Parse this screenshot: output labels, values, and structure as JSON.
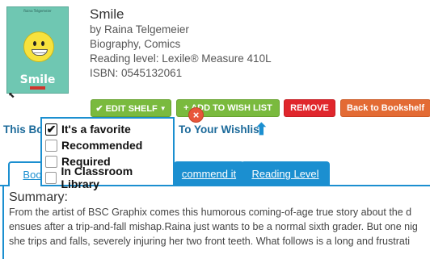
{
  "book": {
    "cover": {
      "author": "Raina Telgemeier",
      "title": "Smile"
    },
    "title": "Smile",
    "author_line": "by Raina Telgemeier",
    "genres": "Biography, Comics",
    "reading_level": "Reading level: Lexile® Measure 410L",
    "isbn": "ISBN: 0545132061"
  },
  "actions": {
    "edit_shelf": "✔ EDIT SHELF",
    "add_wishlist": "+ ADD TO WISH LIST",
    "remove": "REMOVE",
    "back": "Back to Bookshelf"
  },
  "wish_banner": {
    "left": "This Bo",
    "right": "To Your Wishlist"
  },
  "shelf_menu": {
    "items": [
      {
        "label": "It's a favorite",
        "checked": true
      },
      {
        "label": "Recommended",
        "checked": false
      },
      {
        "label": "Required",
        "checked": false
      },
      {
        "label": "In Classroom Library",
        "checked": false
      }
    ],
    "close": "×"
  },
  "tabs": {
    "book": "Boo",
    "recommend": "commend it",
    "reading": "Reading Level"
  },
  "summary": {
    "heading": "Summary:",
    "lines": [
      "From the artist of BSC Graphix comes this humorous coming-of-age true story about the d",
      "ensues after a trip-and-fall mishap.Raina just wants to be a normal sixth grader. But one nig",
      "she trips and falls, severely injuring her two front teeth. What follows is a long and frustrati"
    ]
  },
  "colors": {
    "accent": "#1b8fd0",
    "green": "#7aba3e",
    "red": "#e0262c",
    "orange": "#e36b34"
  }
}
